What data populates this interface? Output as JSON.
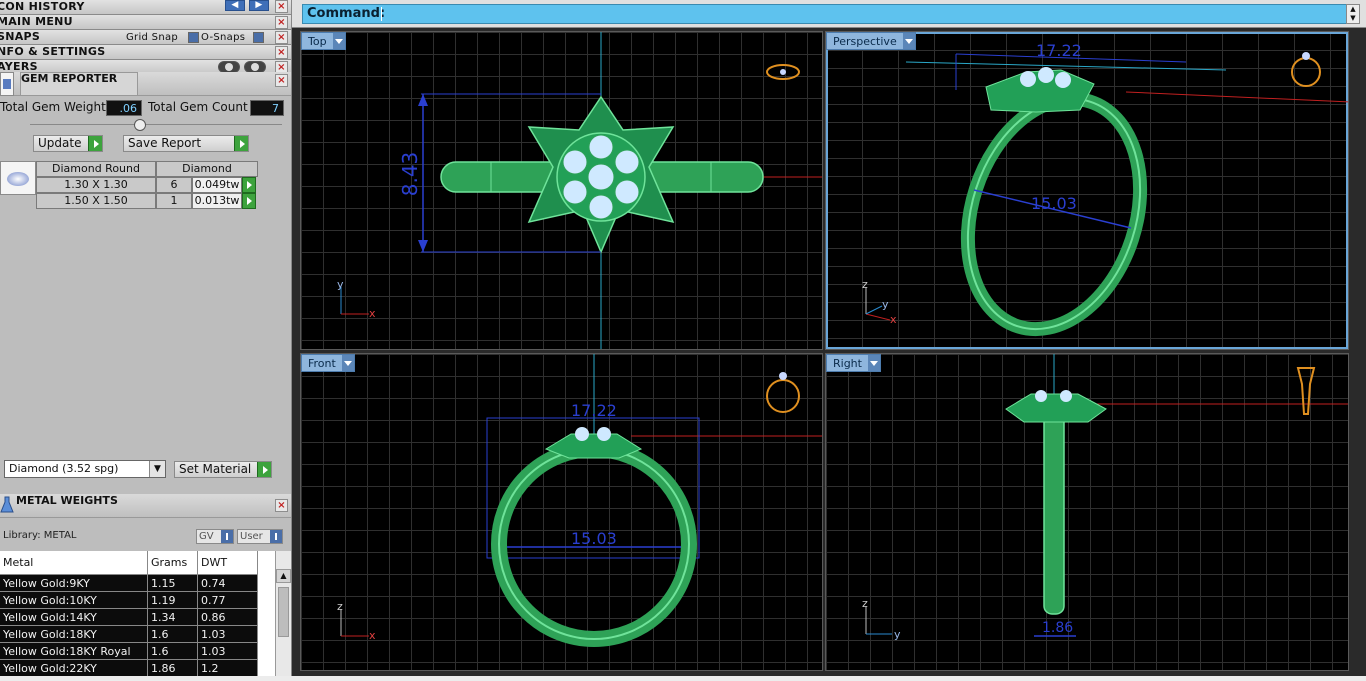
{
  "left_panel": {
    "icon_history": {
      "title": "CON HISTORY"
    },
    "main_menu": {
      "title": "MAIN MENU"
    },
    "snaps": {
      "title": "SNAPS",
      "grid_snap": "Grid Snap",
      "o_snaps": "O-Snaps"
    },
    "info": {
      "title": "NFO & SETTINGS"
    },
    "layers": {
      "title": "AYERS"
    },
    "gem_reporter": {
      "title": "GEM REPORTER",
      "total_weight_label": "Total Gem Weight",
      "total_weight_value": ".06",
      "total_count_label": "Total Gem Count",
      "total_count_value": "7",
      "update_label": "Update",
      "save_report_label": "Save Report",
      "table": {
        "header_shape": "Diamond Round",
        "header_material": "Diamond",
        "rows": [
          {
            "size": "1.30 X 1.30",
            "count": "6",
            "weight": "0.049tw"
          },
          {
            "size": "1.50 X 1.50",
            "count": "1",
            "weight": "0.013tw"
          }
        ]
      },
      "material_select": "Diamond     (3.52 spg)",
      "set_material_label": "Set Material"
    },
    "metal_weights": {
      "title": "METAL WEIGHTS",
      "library": "Library: METAL",
      "gv_label": "GV",
      "user_label": "User",
      "columns": [
        "Metal",
        "Grams",
        "DWT"
      ],
      "rows": [
        [
          "Yellow Gold:9KY",
          "1.15",
          "0.74"
        ],
        [
          "Yellow Gold:10KY",
          "1.19",
          "0.77"
        ],
        [
          "Yellow Gold:14KY",
          "1.34",
          "0.86"
        ],
        [
          "Yellow Gold:18KY",
          "1.6",
          "1.03"
        ],
        [
          "Yellow Gold:18KY Royal",
          "1.6",
          "1.03"
        ],
        [
          "Yellow Gold:22KY",
          "1.86",
          "1.2"
        ]
      ]
    }
  },
  "command": {
    "label": "Command:"
  },
  "viewports": {
    "top": {
      "label": "Top",
      "dim_vertical": "8.43",
      "axis_x": "x",
      "axis_y": "y"
    },
    "perspective": {
      "label": "Perspective",
      "dim_top": "17.22",
      "dim_mid": "15.03",
      "axis_x": "x",
      "axis_y": "y",
      "axis_z": "z"
    },
    "front": {
      "label": "Front",
      "dim_top": "17.22",
      "dim_inner": "15.03",
      "axis_x": "x",
      "axis_z": "z"
    },
    "right": {
      "label": "Right",
      "dim_bottom": "1.86",
      "axis_y": "y",
      "axis_z": "z"
    }
  },
  "colors": {
    "ring_green": "#3fc46a",
    "dimension_blue": "#2a3fd0",
    "gem_blue": "#bfe3ff",
    "grid": "#2f2f2f",
    "tab": "#8fb6dd"
  }
}
